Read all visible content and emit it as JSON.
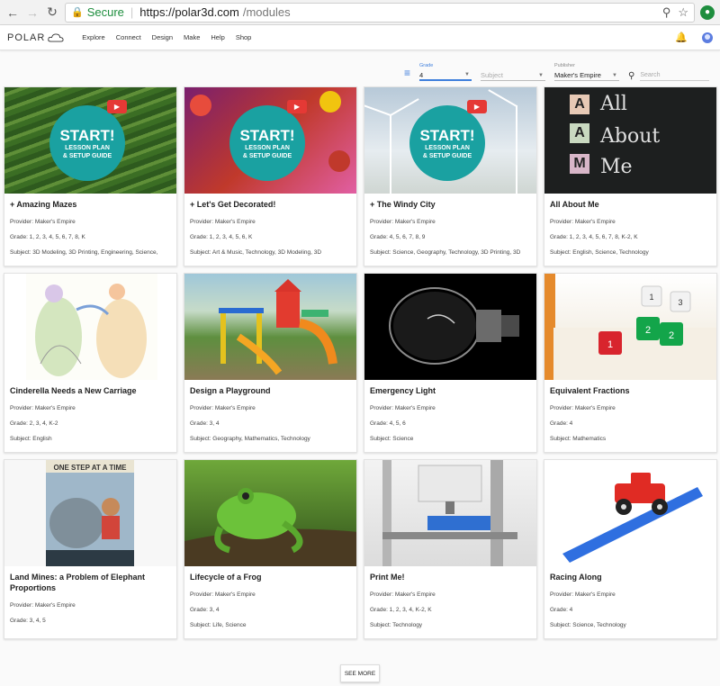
{
  "browser": {
    "secure_label": "Secure",
    "url_host": "https://polar3d.com",
    "url_path": "/modules"
  },
  "appbar": {
    "logo": "POLAR",
    "menu": [
      "Explore",
      "Connect",
      "Design",
      "Make",
      "Help",
      "Shop"
    ]
  },
  "filters": {
    "grade_label": "Grade",
    "grade_value": "4",
    "subject_placeholder": "Subject",
    "publisher_label": "Publisher",
    "publisher_value": "Maker's Empire",
    "search_placeholder": "Search"
  },
  "badge": {
    "start": "START!",
    "line1": "LESSON PLAN",
    "line2": "& SETUP GUIDE"
  },
  "cards": [
    {
      "title": "+ Amazing Mazes",
      "provider": "Provider: Maker's Empire",
      "grade": "Grade: 1, 2, 3, 4, 5, 6, 7, 8, K",
      "subject": "Subject: 3D Modeling, 3D Printing, Engineering, Science,"
    },
    {
      "title": "+ Let's Get Decorated!",
      "provider": "Provider: Maker's Empire",
      "grade": "Grade: 1, 2, 3, 4, 5, 6, K",
      "subject": "Subject: Art & Music, Technology, 3D Modeling, 3D"
    },
    {
      "title": "+ The Windy City",
      "provider": "Provider: Maker's Empire",
      "grade": "Grade: 4, 5, 6, 7, 8, 9",
      "subject": "Subject: Science, Geography, Technology, 3D Printing, 3D"
    },
    {
      "title": "All About Me",
      "provider": "Provider: Maker's Empire",
      "grade": "Grade: 1, 2, 3, 4, 5, 6, 7, 8, K-2, K",
      "subject": "Subject: English, Science, Technology"
    },
    {
      "title": "Cinderella Needs a New Carriage",
      "provider": "Provider: Maker's Empire",
      "grade": "Grade: 2, 3, 4, K-2",
      "subject": "Subject: English"
    },
    {
      "title": "Design a Playground",
      "provider": "Provider: Maker's Empire",
      "grade": "Grade: 3, 4",
      "subject": "Subject: Geography, Mathematics, Technology"
    },
    {
      "title": "Emergency Light",
      "provider": "Provider: Maker's Empire",
      "grade": "Grade: 4, 5, 6",
      "subject": "Subject: Science"
    },
    {
      "title": "Equivalent Fractions",
      "provider": "Provider: Maker's Empire",
      "grade": "Grade: 4",
      "subject": "Subject: Mathematics"
    },
    {
      "title": "Land Mines: a Problem of Elephant Proportions",
      "provider": "Provider: Maker's Empire",
      "grade": "Grade: 3, 4, 5",
      "subject": ""
    },
    {
      "title": "Lifecycle of a Frog",
      "provider": "Provider: Maker's Empire",
      "grade": "Grade: 3, 4",
      "subject": "Subject: Life, Science"
    },
    {
      "title": "Print Me!",
      "provider": "Provider: Maker's Empire",
      "grade": "Grade: 1, 2, 3, 4, K-2, K",
      "subject": "Subject: Technology"
    },
    {
      "title": "Racing Along",
      "provider": "Provider: Maker's Empire",
      "grade": "Grade: 4",
      "subject": "Subject: Science, Technology"
    }
  ],
  "thumb_text": {
    "all_about_me": {
      "A1": "A",
      "A2": "A",
      "M": "M",
      "w1": "All",
      "w2": "About",
      "w3": "Me"
    },
    "fractions": {
      "a": "1",
      "b": "2",
      "c": "2",
      "d": "1",
      "e": "3"
    },
    "book_title": "ONE STEP AT A TIME"
  },
  "see_more": "SEE MORE"
}
